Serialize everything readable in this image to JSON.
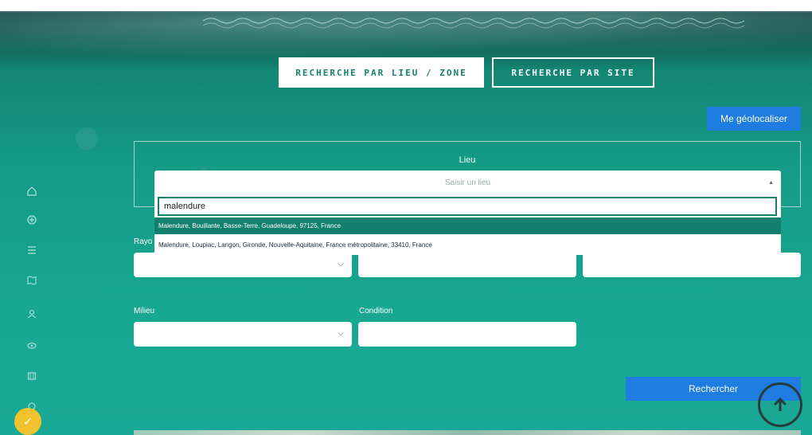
{
  "tabs": [
    {
      "label": "RECHERCHE PAR LIEU / ZONE",
      "active": true
    },
    {
      "label": "RECHERCHE PAR SITE",
      "active": false
    }
  ],
  "geolocate_label": "Me géolocaliser",
  "lieu": {
    "label": "Lieu",
    "placeholder": "Saisir un lieu",
    "search_value": "malendure",
    "results": [
      "Malendure, Bouillante, Basse-Terre, Guadeloupe, 97125, France",
      "Malendure, Loupiac, Langon, Gironde, Nouvelle-Aquitaine, France métropolitaine, 33410, France"
    ]
  },
  "rayon_label": "Rayo",
  "milieu_label": "Milieu",
  "condition_label": "Condition",
  "search_label": "Rechercher",
  "sidebar_icons": [
    "home-icon",
    "add-circle-icon",
    "list-icon",
    "map-icon",
    "user-icon",
    "eye-icon",
    "map-pin-icon",
    "settings-icon"
  ],
  "colors": {
    "accent_blue": "#1f7de0",
    "teal": "#137f6e",
    "badge": "#f2c12e"
  }
}
